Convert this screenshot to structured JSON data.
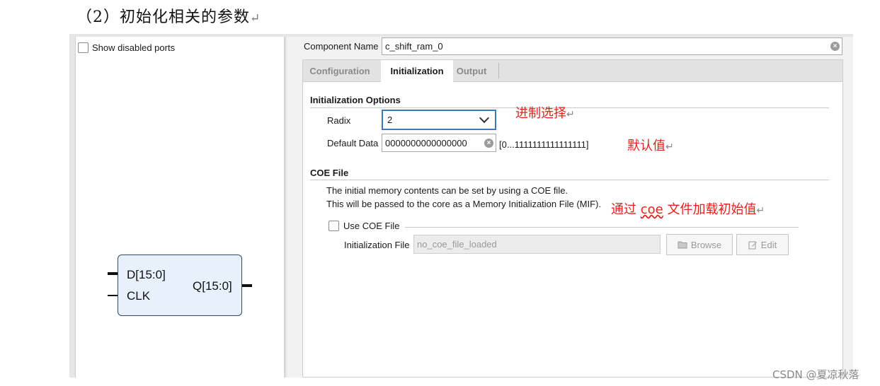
{
  "heading": {
    "text": "（2）初始化相关的参数",
    "return_mark": "↵"
  },
  "left_panel": {
    "show_disabled_ports_label": "Show disabled ports",
    "symbol": {
      "pin_d": "D[15:0]",
      "pin_clk": "CLK",
      "pin_q": "Q[15:0]"
    }
  },
  "component_name": {
    "label": "Component Name",
    "value": "c_shift_ram_0"
  },
  "tabs": [
    {
      "label": "Configuration",
      "active": false
    },
    {
      "label": "Initialization",
      "active": true
    },
    {
      "label": "Output",
      "active": false
    }
  ],
  "init_options": {
    "title": "Initialization Options",
    "radix_label": "Radix",
    "radix_value": "2",
    "default_data_label": "Default Data",
    "default_data_value": "0000000000000000",
    "default_data_range": "[0...1111111111111111]"
  },
  "coe": {
    "title": "COE File",
    "desc_line1": "The initial memory contents can be set by using a COE file.",
    "desc_line2": "This will be passed to the core as a Memory Initialization File (MIF).",
    "use_coe_label": "Use COE File",
    "init_file_label": "Initialization File",
    "init_file_value": "no_coe_file_loaded",
    "browse_label": "Browse",
    "edit_label": "Edit"
  },
  "annotations": {
    "radix_note": "进制选择",
    "default_note": "默认值",
    "coe_note_prefix": "通过 ",
    "coe_note_word": "coe",
    "coe_note_suffix": " 文件加载初始值",
    "return_mark": "↵"
  },
  "watermark": "CSDN @夏凉秋落",
  "colors": {
    "annotation_red": "#e0211d",
    "focus_blue": "#3b78c4",
    "symbol_fill": "#e7f0fb"
  }
}
